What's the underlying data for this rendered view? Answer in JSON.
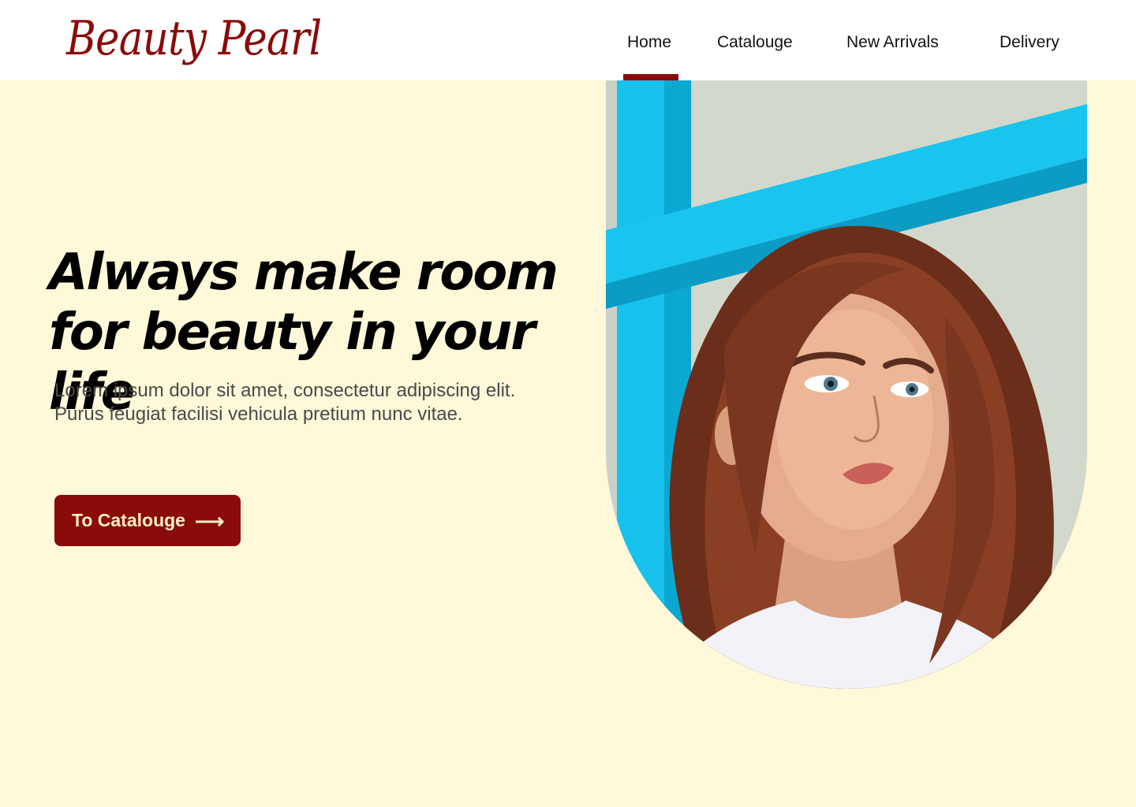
{
  "brand": {
    "logo_text": "Beauty Pearl"
  },
  "nav": {
    "items": [
      {
        "label": "Home",
        "active": true
      },
      {
        "label": "Catalouge",
        "active": false
      },
      {
        "label": "New Arrivals",
        "active": false
      },
      {
        "label": "Delivery",
        "active": false
      }
    ]
  },
  "hero": {
    "title_line1": "Always make room",
    "title_line2": "for beauty in your life",
    "subtitle": "Lorem ipsum dolor sit amet, consectetur adipiscing elit. Purus feugiat facilisi vehicula pretium nunc vitae.",
    "cta_label": "To Catalouge",
    "cta_icon": "arrow-right-icon",
    "image_icon": "woman-portrait-photo"
  },
  "colors": {
    "accent": "#8B0A0A",
    "background": "#FFF8D9",
    "header_bg": "#FFFFFF",
    "cta_text": "#FFF2C6"
  }
}
